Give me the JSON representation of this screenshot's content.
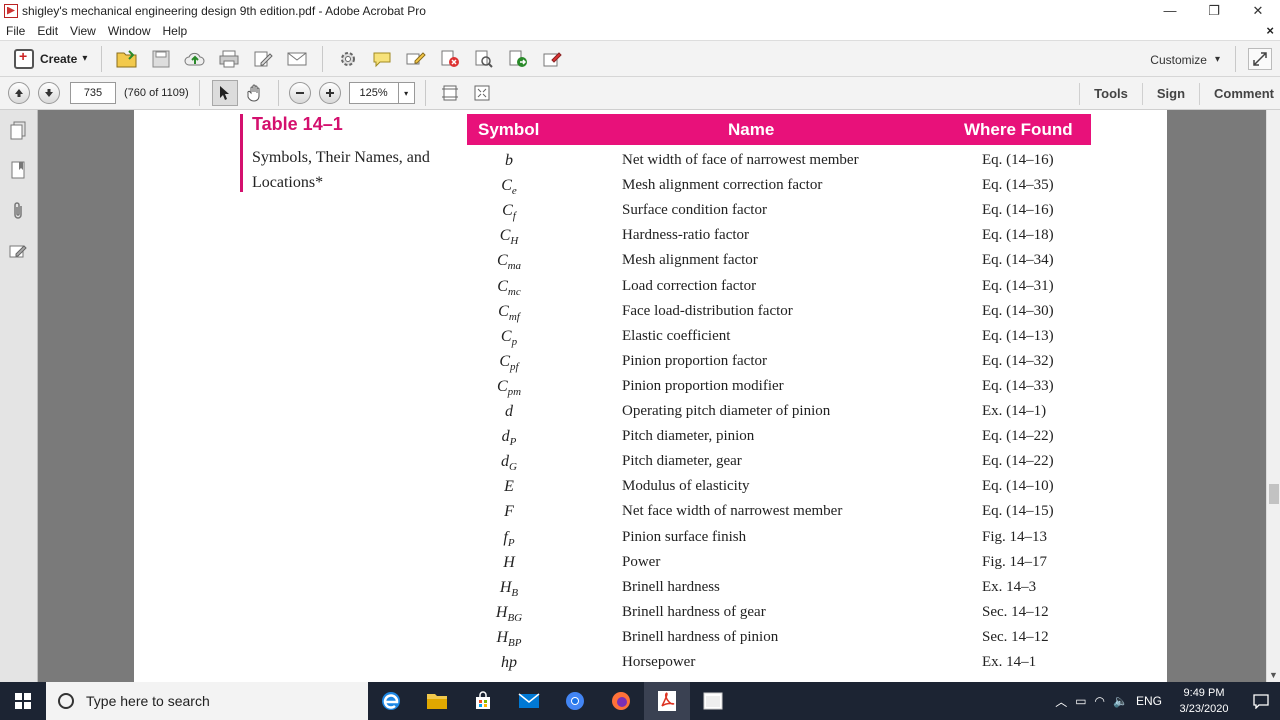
{
  "window": {
    "title": "shigley's mechanical engineering design 9th edition.pdf - Adobe Acrobat Pro",
    "minimize": "—",
    "restore": "❐",
    "close": "✕"
  },
  "menu": {
    "items": [
      "File",
      "Edit",
      "View",
      "Window",
      "Help"
    ],
    "close_doc": "×"
  },
  "toolbar": {
    "create_label": "Create",
    "create_arrow": "▾",
    "customize_label": "Customize",
    "customize_arrow": "▾"
  },
  "nav": {
    "page_number": "735",
    "page_count": "(760 of 1109)",
    "zoom": "125%",
    "zoom_arrow": "▾",
    "panes": [
      "Tools",
      "Sign",
      "Comment"
    ]
  },
  "document": {
    "table_number": "Table 14–1",
    "table_caption": "Symbols, Their Names, and Locations*",
    "columns": [
      "Symbol",
      "Name",
      "Where Found"
    ],
    "rows": [
      {
        "base": "b",
        "sub": "",
        "name": "Net width of face of narrowest member",
        "where": "Eq. (14–16)"
      },
      {
        "base": "C",
        "sub": "e",
        "name": "Mesh alignment correction factor",
        "where": "Eq. (14–35)"
      },
      {
        "base": "C",
        "sub": "f",
        "name": "Surface condition factor",
        "where": "Eq. (14–16)"
      },
      {
        "base": "C",
        "sub": "H",
        "name": "Hardness-ratio factor",
        "where": "Eq. (14–18)"
      },
      {
        "base": "C",
        "sub": "ma",
        "name": "Mesh alignment factor",
        "where": "Eq. (14–34)"
      },
      {
        "base": "C",
        "sub": "mc",
        "name": "Load correction factor",
        "where": "Eq. (14–31)"
      },
      {
        "base": "C",
        "sub": "mf",
        "name": "Face load-distribution factor",
        "where": "Eq. (14–30)"
      },
      {
        "base": "C",
        "sub": "p",
        "name": "Elastic coefficient",
        "where": "Eq. (14–13)"
      },
      {
        "base": "C",
        "sub": "pf",
        "name": "Pinion proportion factor",
        "where": "Eq. (14–32)"
      },
      {
        "base": "C",
        "sub": "pm",
        "name": "Pinion proportion modifier",
        "where": "Eq. (14–33)"
      },
      {
        "base": "d",
        "sub": "",
        "name": "Operating pitch diameter of pinion",
        "where": "Ex. (14–1)"
      },
      {
        "base": "d",
        "sub": "P",
        "name": "Pitch diameter, pinion",
        "where": "Eq. (14–22)"
      },
      {
        "base": "d",
        "sub": "G",
        "name": "Pitch diameter, gear",
        "where": "Eq. (14–22)"
      },
      {
        "base": "E",
        "sub": "",
        "name": "Modulus of elasticity",
        "where": "Eq. (14–10)"
      },
      {
        "base": "F",
        "sub": "",
        "name": "Net face width of narrowest member",
        "where": "Eq. (14–15)"
      },
      {
        "base": "f",
        "sub": "P",
        "name": "Pinion surface finish",
        "where": "Fig. 14–13"
      },
      {
        "base": "H",
        "sub": "",
        "name": "Power",
        "where": "Fig. 14–17"
      },
      {
        "base": "H",
        "sub": "B",
        "name": "Brinell hardness",
        "where": "Ex. 14–3"
      },
      {
        "base": "H",
        "sub": "BG",
        "name": "Brinell hardness of gear",
        "where": "Sec. 14–12"
      },
      {
        "base": "H",
        "sub": "BP",
        "name": "Brinell hardness of pinion",
        "where": "Sec. 14–12"
      },
      {
        "base": "hp",
        "sub": "",
        "name": "Horsepower",
        "where": "Ex. 14–1"
      }
    ]
  },
  "taskbar": {
    "search_placeholder": "Type here to search",
    "language": "ENG",
    "time": "9:49 PM",
    "date": "3/23/2020"
  }
}
